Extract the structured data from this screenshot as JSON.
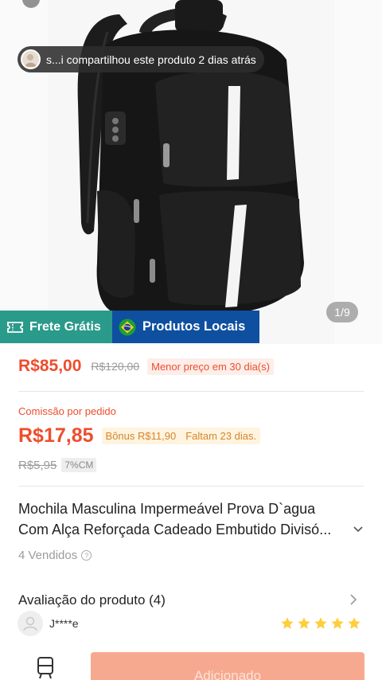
{
  "share_banner": {
    "text": "s...i compartilhou este produto 2 dias atrás"
  },
  "image_counter": "1/9",
  "badges": {
    "frete": "Frete Grátis",
    "locais": "Produtos Locais"
  },
  "price": {
    "current": "R$85,00",
    "original": "R$120,00",
    "lowest_tag": "Menor preço em 30 dia(s)"
  },
  "commission": {
    "label": "Comissão por pedido",
    "value": "R$17,85",
    "bonus": "Bônus R$11,90",
    "remaining": "Faltam 23 dias.",
    "old_value": "R$5,95",
    "cm_tag": "7%CM"
  },
  "product": {
    "title_line1": "Mochila Masculina Impermeável Prova D`agua",
    "title_line2": "Com Alça Reforçada Cadeado Embutido Divisó...",
    "sold": "4 Vendidos"
  },
  "reviews": {
    "title": "Avaliação do produto (4)",
    "reviewer": "J****e",
    "rating": 5
  },
  "bottom": {
    "add_button": "Adicionado"
  },
  "colors": {
    "accent": "#ee4d2d",
    "frete_bg": "#2a9a8a",
    "locais_bg": "#0e4fa0",
    "star": "#ffce3d"
  }
}
